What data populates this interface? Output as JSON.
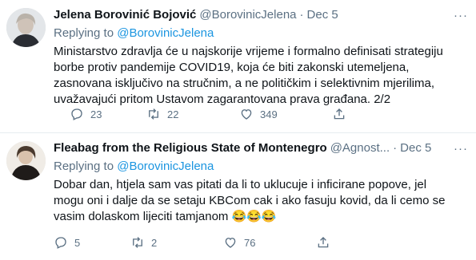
{
  "tweets": [
    {
      "name": "Jelena Borovinić Bojović",
      "handle": "@BorovinicJelena",
      "separator": "·",
      "date": "Dec 5",
      "replying_prefix": "Replying to",
      "replying_handle": "@BorovinicJelena",
      "text": "Ministarstvo zdravlja će u najskorije vrijeme i formalno definisati strategiju borbe protiv pandemije COVID19, koja će biti zakonski utemeljena, zasnovana isključivo na stručnim, a ne političkim i selektivnim mjerilima, uvažavajući pritom Ustavom zagarantovana prava građana. 2/2",
      "reply_count": "23",
      "retweet_count": "22",
      "like_count": "349",
      "more_icon": "more-dots-icon"
    },
    {
      "name": "Fleabag from the Religious State of Montenegro",
      "handle": "@Agnost...",
      "separator": "·",
      "date": "Dec 5",
      "replying_prefix": "Replying to",
      "replying_handle": "@BorovinicJelena",
      "text": "Dobar dan,  htjela sam vas pitati da li to uklucuje i inficirane popove, jel mogu oni i dalje da se setaju KBCom cak i ako fasuju kovid, da li cemo se vasim dolaskom lijeciti tamjanom 😂😂😂",
      "reply_count": "5",
      "retweet_count": "2",
      "like_count": "76",
      "more_icon": "more-dots-icon"
    }
  ],
  "colors": {
    "link": "#1b95e0",
    "secondary_text": "#5b7083",
    "divider": "#e6ecf0"
  }
}
